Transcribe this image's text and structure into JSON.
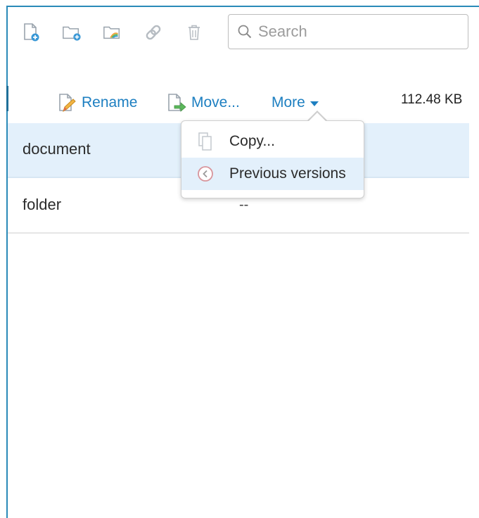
{
  "search": {
    "placeholder": "Search"
  },
  "toolbar": {
    "icons": [
      "new-file-icon",
      "new-folder-icon",
      "upload-folder-icon",
      "link-icon",
      "trash-icon"
    ]
  },
  "actions": {
    "rename": "Rename",
    "move": "Move...",
    "more": "More"
  },
  "header": {
    "size": "112.48 KB"
  },
  "files": [
    {
      "name": "document",
      "size": ""
    },
    {
      "name": "folder",
      "size": "--"
    }
  ],
  "more_menu": {
    "items": [
      {
        "label": "Copy...",
        "icon": "copy-icon"
      },
      {
        "label": "Previous versions",
        "icon": "history-icon"
      }
    ]
  },
  "colors": {
    "accent": "#1d7fc1",
    "frame": "#2a8ab8",
    "selected_row": "#e3f0fb"
  }
}
